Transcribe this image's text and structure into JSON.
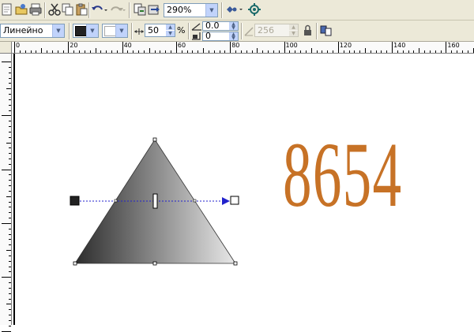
{
  "toolbar": {
    "zoom_level": "290%",
    "icons": [
      "new-icon",
      "open-icon",
      "print-icon",
      "cut-icon",
      "copy-icon",
      "paste-icon",
      "undo-icon",
      "redo-icon",
      "import-icon",
      "export-icon",
      "zoom-icon",
      "app-launcher-icon",
      "corel-online-icon"
    ]
  },
  "property_bar": {
    "fill_type": "Линейно",
    "start_color": "#222222",
    "end_color": "#ffffff",
    "midpoint": "50",
    "midpoint_unit": "%",
    "angle": "0.0",
    "edge_pad": "0",
    "steps": "256"
  },
  "ruler": {
    "labels": [
      "0",
      "20",
      "40",
      "60",
      "80",
      "100",
      "120",
      "140",
      "160"
    ]
  },
  "canvas": {
    "text_object": "8654",
    "text_color": "#c77226",
    "triangle_gradient": [
      "#2c2c2c",
      "#e8e8e8"
    ]
  }
}
